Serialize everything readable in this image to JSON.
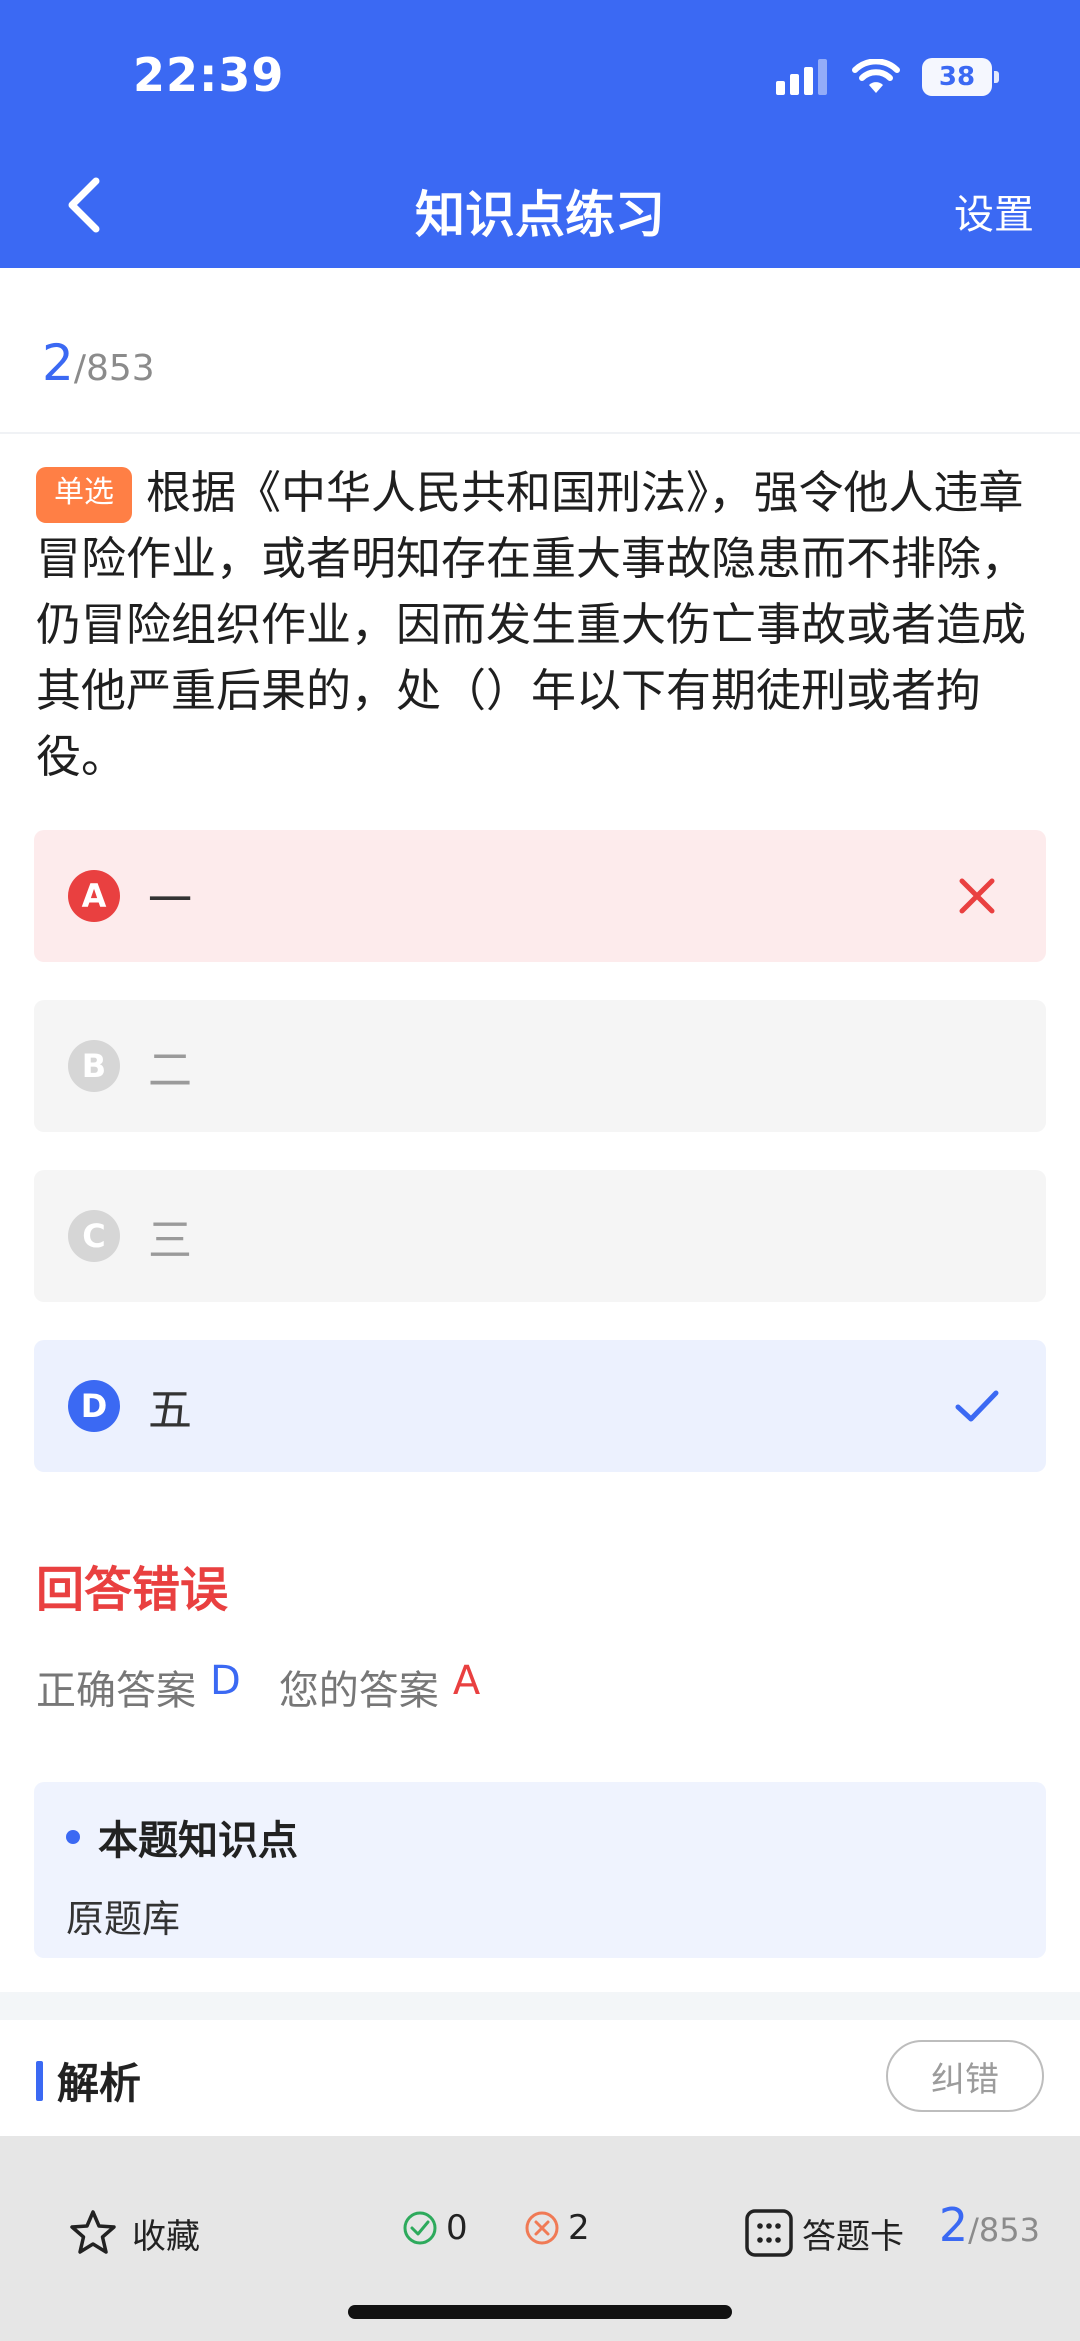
{
  "status": {
    "time": "22:39",
    "battery": "38"
  },
  "nav": {
    "title": "知识点练习",
    "settings": "设置"
  },
  "progress": {
    "current": "2",
    "total": "/853"
  },
  "question": {
    "tag": "单选",
    "text": "根据《中华人民共和国刑法》，强令他人违章冒险作业，或者明知存在重大事故隐患而不排除，仍冒险组织作业，因而发生重大伤亡事故或者造成其他严重后果的，处（）年以下有期徒刑或者拘役。"
  },
  "options": [
    {
      "letter": "A",
      "text": "一",
      "state": "wrong"
    },
    {
      "letter": "B",
      "text": "二",
      "state": "disabled"
    },
    {
      "letter": "C",
      "text": "三",
      "state": "disabled"
    },
    {
      "letter": "D",
      "text": "五",
      "state": "correct"
    }
  ],
  "result": {
    "title": "回答错误",
    "correct_label": "正确答案",
    "correct_value": "D",
    "yours_label": "您的答案",
    "yours_value": "A"
  },
  "knowledge": {
    "title": "本题知识点",
    "body": "原题库"
  },
  "analysis": {
    "title": "解析",
    "report": "纠错"
  },
  "bottom": {
    "favorite": "收藏",
    "right_count": "0",
    "wrong_count": "2",
    "answer_card": "答题卡",
    "current": "2",
    "total": "/853"
  },
  "colors": {
    "primary": "#3B69F3",
    "error": "#E94040",
    "tag": "#FF7F45"
  },
  "icons": [
    "back-arrow-icon",
    "signal-icon",
    "wifi-icon",
    "battery-icon",
    "close-x-icon",
    "check-icon",
    "star-icon",
    "check-circle-icon",
    "x-circle-icon",
    "grid-icon"
  ]
}
